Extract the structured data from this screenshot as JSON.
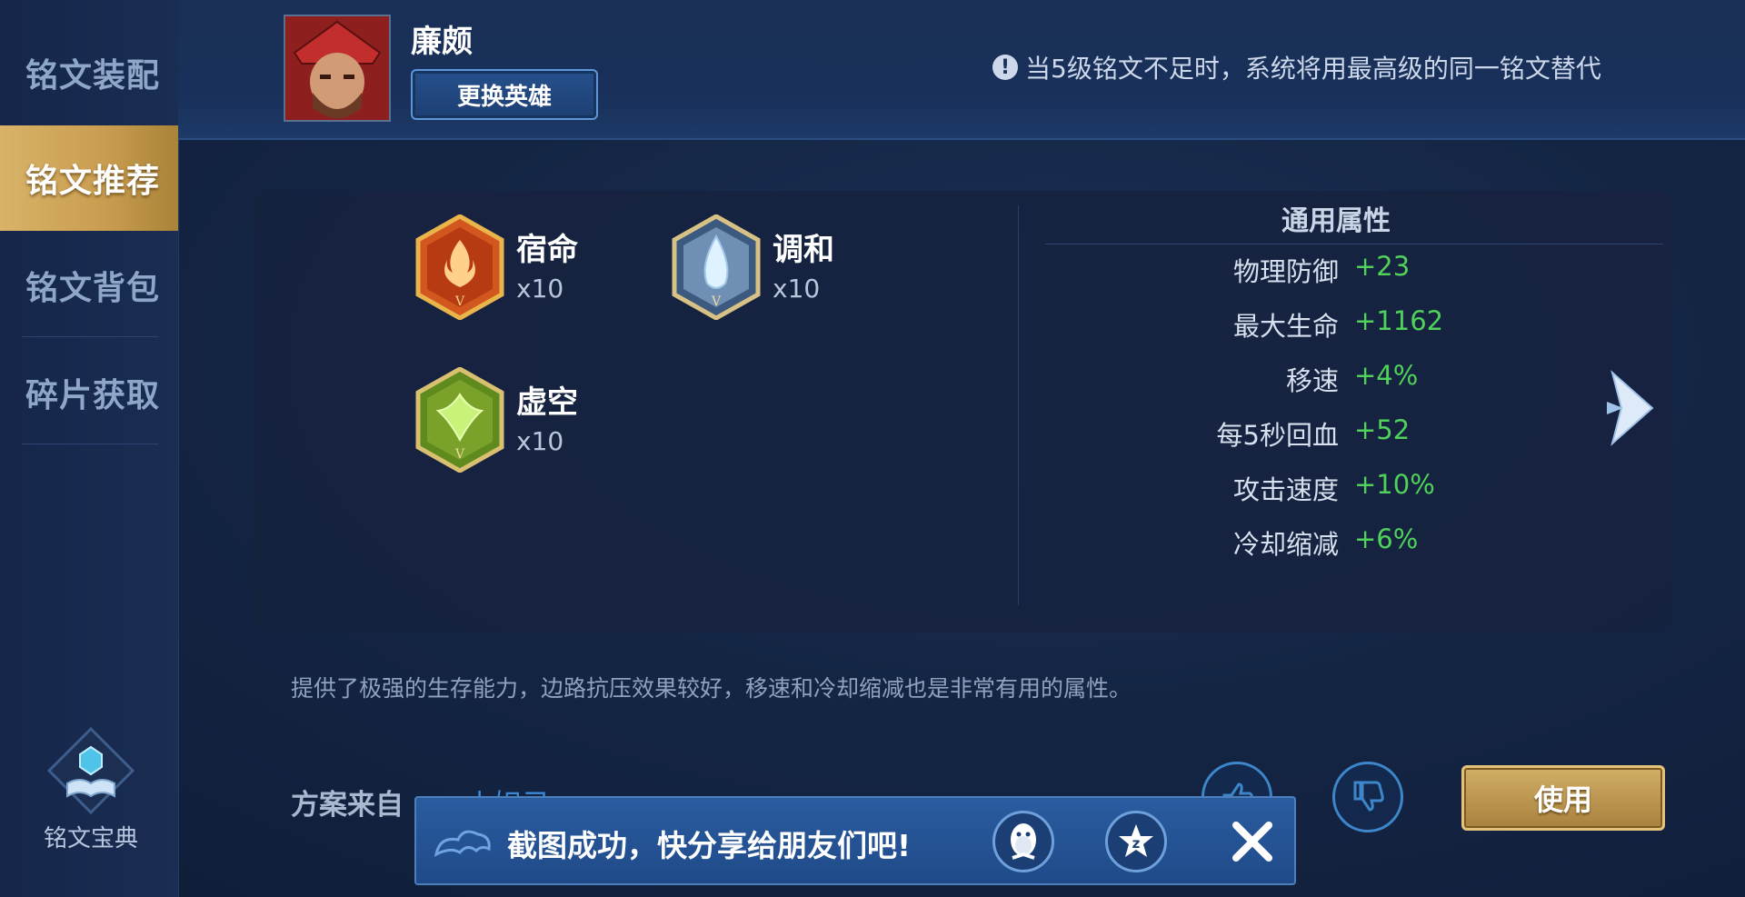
{
  "sidebar": {
    "items": [
      {
        "label": "铭文装配",
        "active": false
      },
      {
        "label": "铭文推荐",
        "active": true
      },
      {
        "label": "铭文背包",
        "active": false
      },
      {
        "label": "碎片获取",
        "active": false
      }
    ],
    "codex_label": "铭文宝典"
  },
  "header": {
    "hero_name": "廉颇",
    "change_hero_label": "更换英雄",
    "notice": "当5级铭文不足时，系统将用最高级的同一铭文替代"
  },
  "runes": [
    {
      "name": "宿命",
      "count": "x10",
      "color": "#d2571e"
    },
    {
      "name": "调和",
      "count": "x10",
      "color": "#6f8fb4"
    },
    {
      "name": "虚空",
      "count": "x10",
      "color": "#7aa12a"
    }
  ],
  "attributes": {
    "title": "通用属性",
    "rows": [
      {
        "label": "物理防御",
        "value": "+23"
      },
      {
        "label": "最大生命",
        "value": "+1162"
      },
      {
        "label": "移速",
        "value": "+4%"
      },
      {
        "label": "每5秒回血",
        "value": "+52"
      },
      {
        "label": "攻击速度",
        "value": "+10%"
      },
      {
        "label": "冷却缩减",
        "value": "+6%"
      }
    ]
  },
  "description": "提供了极强的生存能力，边路抗压效果较好，移速和冷却缩减也是非常有用的属性。",
  "source": {
    "label": "方案来自",
    "author": "小妲己"
  },
  "use_button_label": "使用",
  "toast": {
    "message": "截图成功，快分享给朋友们吧!"
  },
  "colors": {
    "accent_gold": "#c99d4f",
    "positive": "#4fd15a",
    "link_blue": "#3a8ad8"
  }
}
